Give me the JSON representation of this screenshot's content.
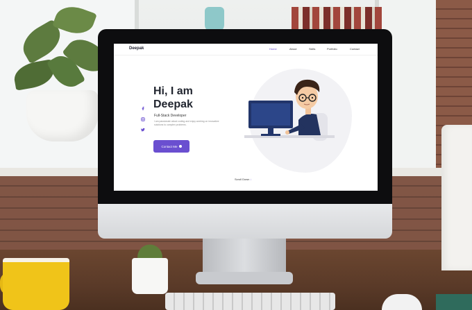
{
  "site": {
    "logo": "Deepak",
    "nav": [
      "Home",
      "About",
      "Skills",
      "Portfolio",
      "Contact"
    ],
    "active_nav": "Home",
    "hero": {
      "title": "Hi, I am Deepak",
      "subtitle": "Full-Stack Developer",
      "description": "I am passionate about coding and enjoy working on innovative solutions to complex problems.",
      "contact_button": "Contact Me"
    },
    "scroll_hint": "Scroll Down"
  },
  "icons": [
    "facebook-icon",
    "instagram-icon",
    "twitter-icon",
    "arrow-down-icon"
  ],
  "colors": {
    "accent": "#6a4fd0",
    "heading": "#21252f",
    "body_text": "#8a8a8a",
    "screen_bg": "#ffffff"
  }
}
